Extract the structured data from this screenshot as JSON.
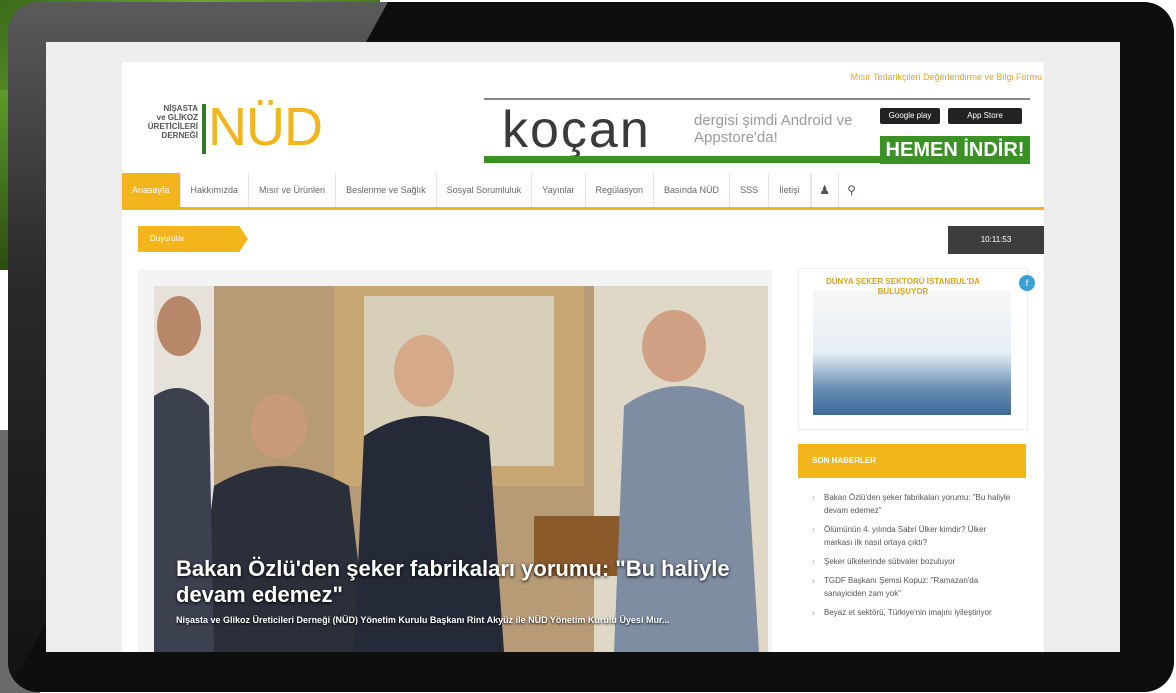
{
  "util": {
    "link": "Mısır Tedarikçileri Değerlendirme ve Bilgi Formu"
  },
  "logo": {
    "small_lines": [
      "NİŞASTA",
      "ve GLİKOZ",
      "ÜRETİCİLERİ",
      "DERNEĞİ"
    ],
    "big": "NÜD"
  },
  "banner": {
    "brand": "koçan",
    "tagline": "dergisi şimdi Android ve Appstore'da!",
    "google_play": "Google play",
    "app_store": "App Store",
    "cta": "HEMEN İNDİR!"
  },
  "nav": {
    "items": [
      "Anasayfa",
      "Hakkımızda",
      "Mısır ve Ürünleri",
      "Beslenme ve Sağlık",
      "Sosyal Sorumluluk",
      "Yayınlar",
      "Regülasyon",
      "Basında NÜD",
      "SSS",
      "İletişi"
    ]
  },
  "ticker": {
    "label": "Duyurular",
    "time": "10:11:53"
  },
  "hero": {
    "title": "Bakan Özlü'den şeker fabrikaları yorumu: \"Bu haliyle devam edemez\"",
    "subtitle": "Nişasta ve Glikoz Üreticileri Derneği (NÜD) Yönetim Kurulu Başkanı Rint Akyüz ile NÜD Yönetim Kurulu Üyesi Mur..."
  },
  "side_ad": {
    "title": "DÜNYA ŞEKER SEKTÖRÜ İSTANBUL'DA BULUŞUYOR"
  },
  "news": {
    "header": "SON HABERLER",
    "items": [
      "Bakan Özlü'den şeker fabrikaları yorumu: \"Bu haliyle devam edemez\"",
      "Ölümünün 4. yılında Sabri Ülker kimdir? Ülker markası ilk nasıl ortaya çıktı?",
      "Şeker ülkelerinde sübvaler bozuluyor",
      "TGDF Başkanı Şemsi Kopuz: \"Ramazan'da sanayiciden zam yok\"",
      "Beyaz et sektörü, Türkiye'nin imajını iyileştiriyor"
    ]
  },
  "colors": {
    "accent": "#f2b51c",
    "green": "#3b9126",
    "dark": "#3d3d3d"
  }
}
